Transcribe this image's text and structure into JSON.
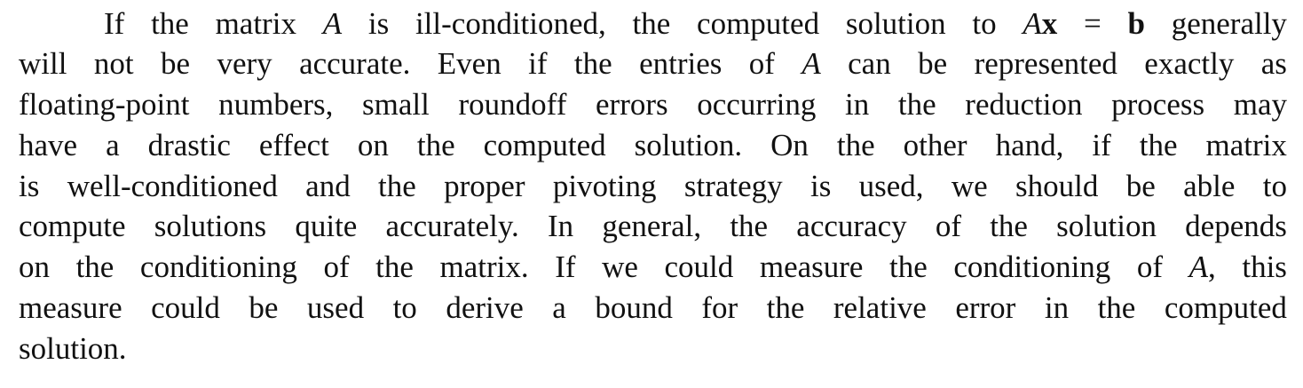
{
  "document": {
    "paragraph": {
      "lines": [
        "If the matrix A is ill-conditioned, the computed solution to Ax = b generally",
        "will not be very accurate. Even if the entries of A can be represented exactly as",
        "floating-point numbers, small roundoff errors occurring in the reduction process may",
        "have a drastic effect on the computed solution. On the other hand, if the matrix",
        "is well-conditioned and the proper pivoting strategy is used, we should be able to",
        "compute solutions quite accurately. In general, the accuracy of the solution depends",
        "on the conditioning of the matrix. If we could measure the conditioning of A, this",
        "measure could be used to derive a bound for the relative error in the computed",
        "solution."
      ]
    }
  }
}
